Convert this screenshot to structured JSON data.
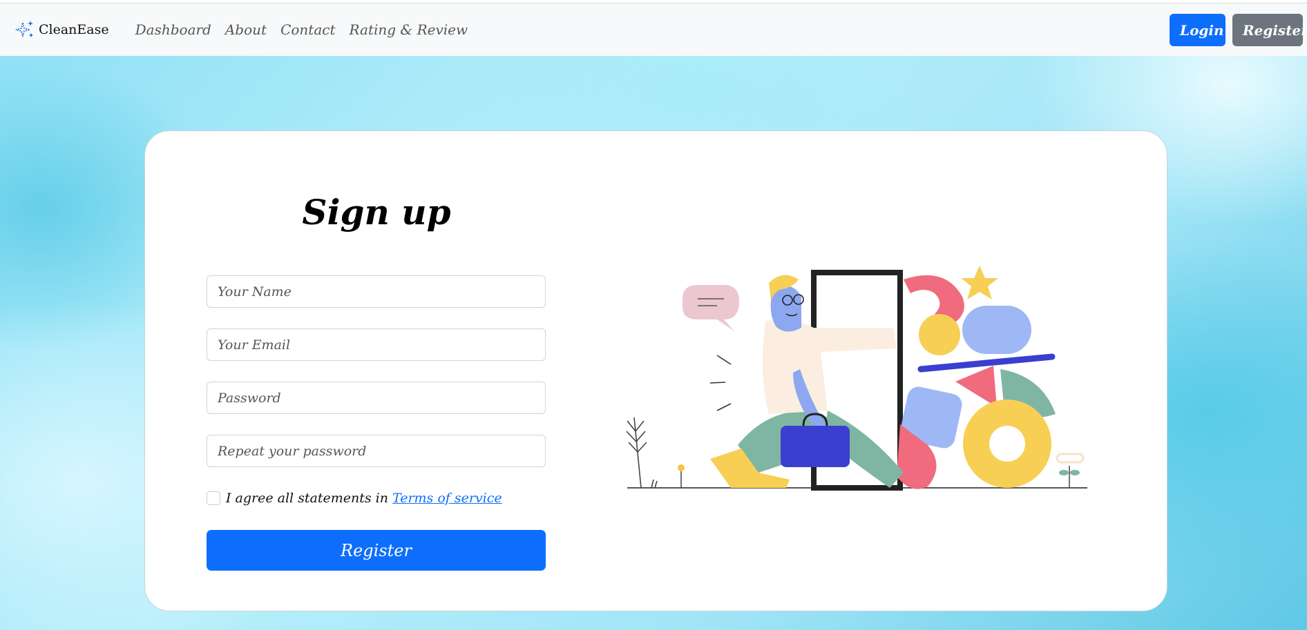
{
  "navbar": {
    "brand": "CleanEase",
    "links": [
      "Dashboard",
      "About",
      "Contact",
      "Rating & Review"
    ],
    "login_label": "Login",
    "register_label": "Register"
  },
  "form": {
    "title": "Sign up",
    "name_placeholder": "Your Name",
    "email_placeholder": "Your Email",
    "password_placeholder": "Password",
    "repeat_password_placeholder": "Repeat your password",
    "terms_text": "I agree all statements in",
    "terms_link": "Terms of service",
    "submit_label": "Register"
  },
  "colors": {
    "primary": "#0d6efd",
    "secondary": "#6c757d",
    "navbar_bg": "#f8f9fa"
  },
  "icons": {
    "brand": "sparkles-icon"
  }
}
